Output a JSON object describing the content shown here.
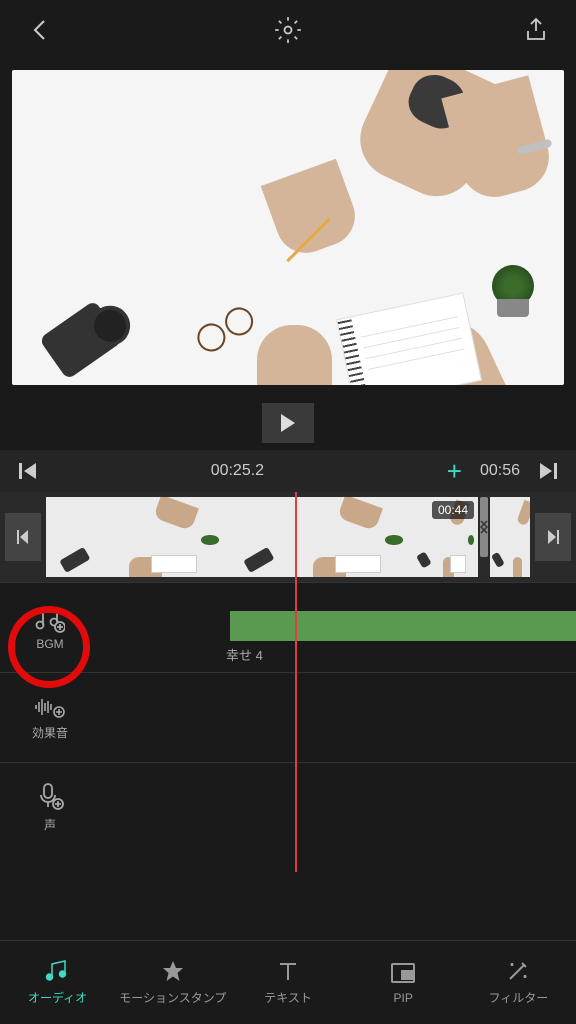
{
  "timeline": {
    "current_time": "00:25.2",
    "total_time": "00:56",
    "clip_badge": "00:44"
  },
  "tracks": {
    "bgm": {
      "label": "BGM",
      "clip_name": "幸せ 4"
    },
    "sfx": {
      "label": "効果音"
    },
    "voice": {
      "label": "声"
    }
  },
  "tabs": {
    "audio": "オーディオ",
    "motion": "モーションスタンプ",
    "text": "テキスト",
    "pip": "PIP",
    "filter": "フィルター"
  }
}
